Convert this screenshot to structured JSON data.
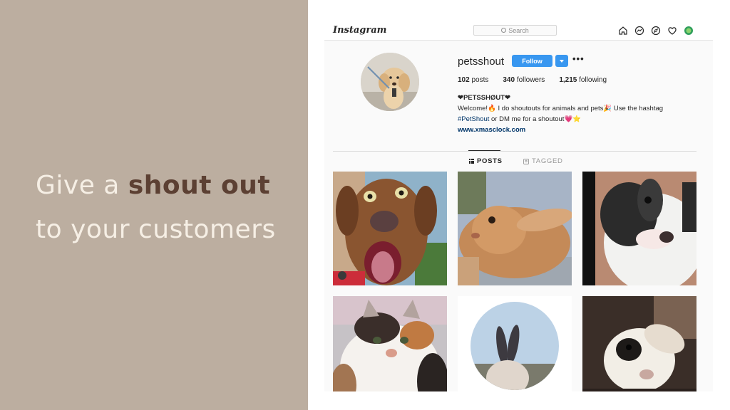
{
  "slide": {
    "headline_pre": "Give a ",
    "headline_bold": "shout out",
    "headline_post": " to your customers",
    "colors": {
      "panel": "#bcaea0",
      "text": "#f6efe5",
      "bold": "#5c4033"
    }
  },
  "instagram": {
    "logo": "Instagram",
    "search_placeholder": "Search",
    "nav_icons": [
      "home-icon",
      "messenger-icon",
      "explore-icon",
      "heart-icon",
      "profile-icon"
    ],
    "profile": {
      "username": "petsshout",
      "follow_label": "Follow",
      "more_label": "•••",
      "posts_count": "102",
      "posts_label": "posts",
      "followers_count": "340",
      "followers_label": "followers",
      "following_count": "1,215",
      "following_label": "following",
      "bio_name": "❤PETSSHØUT❤",
      "bio_line1": "Welcome!🔥 I do shoutouts for animals and pets🎉 Use the hashtag",
      "bio_hashtag": "#PetShout",
      "bio_line2_rest": " or DM me for a shoutout💗⭐",
      "website": "www.xmasclock.com"
    },
    "tabs": {
      "posts": "POSTS",
      "tagged": "TAGGED"
    },
    "posts": [
      {
        "name": "post-dog",
        "subject": "brown dog"
      },
      {
        "name": "post-rabbit-tan",
        "subject": "tan rabbit"
      },
      {
        "name": "post-rabbit-bw",
        "subject": "black and white rabbit"
      },
      {
        "name": "post-cat",
        "subject": "calico cat"
      },
      {
        "name": "post-bunny-ears",
        "subject": "bunny ears"
      },
      {
        "name": "post-rabbit-dark",
        "subject": "rabbit close-up"
      }
    ],
    "colors": {
      "accent": "#3897f0",
      "link": "#003569"
    }
  }
}
